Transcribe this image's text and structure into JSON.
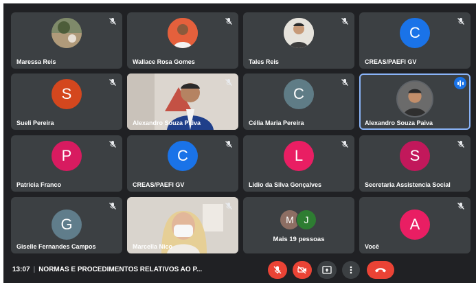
{
  "participants": [
    {
      "name": "Maressa Reis",
      "muted": true,
      "avatar": "photo"
    },
    {
      "name": "Wallace Rosa Gomes",
      "muted": true,
      "avatar": "photo"
    },
    {
      "name": "Tales Reis",
      "muted": true,
      "avatar": "photo"
    },
    {
      "name": "CREAS/PAEFI GV",
      "muted": true,
      "initial": "C",
      "color": "#1a73e8"
    },
    {
      "name": "Sueli Pereira",
      "muted": true,
      "initial": "S",
      "color": "#d4471e"
    },
    {
      "name": "Alexandro Souza Paiva",
      "muted": true,
      "avatar": "video"
    },
    {
      "name": "Célia Maria Pereira",
      "muted": true,
      "initial": "C",
      "color": "#5f7c86"
    },
    {
      "name": "Alexandro Souza Paiva",
      "muted": false,
      "speaking": true,
      "avatar": "photo"
    },
    {
      "name": "Patricia Franco",
      "muted": true,
      "initial": "P",
      "color": "#d81b60"
    },
    {
      "name": "CREAS/PAEFI GV",
      "muted": true,
      "initial": "C",
      "color": "#1a73e8"
    },
    {
      "name": "Lidio da Silva Gonçalves",
      "muted": true,
      "initial": "L",
      "color": "#e91e63"
    },
    {
      "name": "Secretaria Assistencia Social",
      "muted": true,
      "initial": "S",
      "color": "#c2185b"
    },
    {
      "name": "Giselle Fernandes Campos",
      "muted": true,
      "initial": "G",
      "color": "#607d8b"
    },
    {
      "name": "Marcella Nico",
      "muted": true,
      "avatar": "video"
    }
  ],
  "more": {
    "label": "Mais 19 pessoas",
    "initials": [
      "M",
      "J"
    ],
    "colors": [
      "#8d6e63",
      "#2e7d32"
    ]
  },
  "self": {
    "name": "Você",
    "initial": "A",
    "color": "#e91e63",
    "muted": true
  },
  "meeting": {
    "time": "13:07",
    "separator": "|",
    "title": "NORMAS E PROCEDIMENTOS RELATIVOS AO P..."
  },
  "controls": [
    "mic-off-icon",
    "camera-off-icon",
    "present-screen-icon",
    "more-options-icon",
    "end-call-icon"
  ],
  "colors": {
    "background": "#202124",
    "tile": "#3c4043",
    "danger": "#ea4335",
    "active_border": "#8ab4f8"
  }
}
